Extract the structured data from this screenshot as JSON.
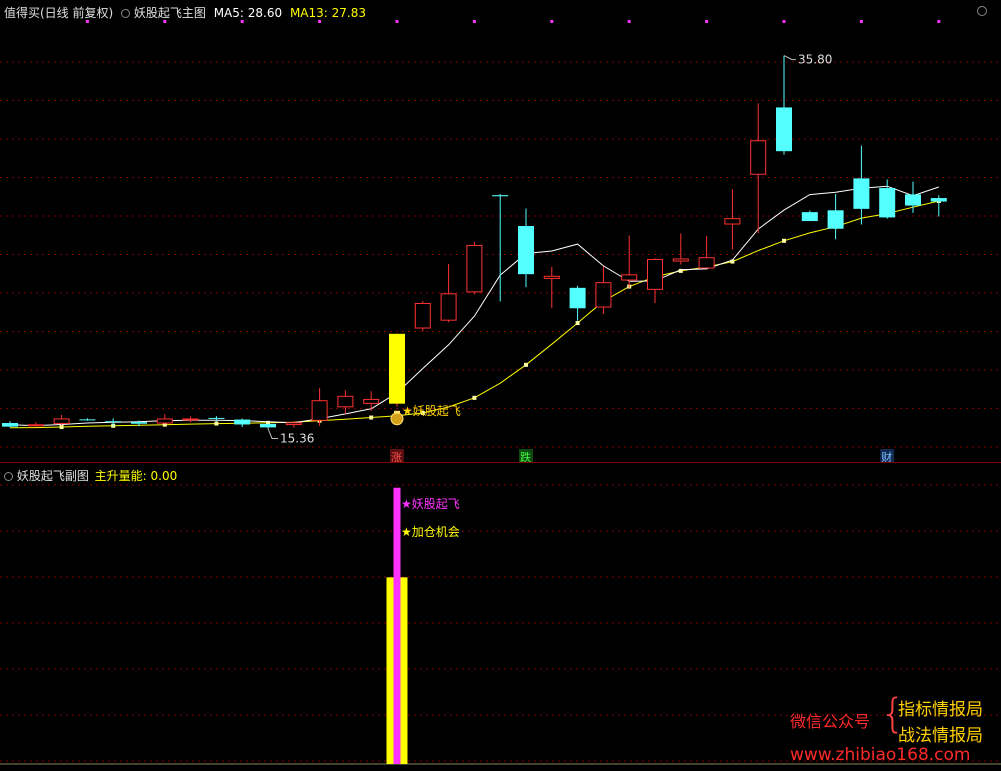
{
  "colors": {
    "up": "#ff3232",
    "down": "#54ffff",
    "ma5": "#ffffff",
    "ma13": "#ffff00",
    "magenta": "#ff32ff",
    "yellow": "#ffff00",
    "grid": "#7f0000",
    "gold": "#ffd000"
  },
  "main_header": {
    "app_name": "值得买(日线 前复权)",
    "indicator": "妖股起飞主图",
    "ma5_label": "MA5: 28.60",
    "ma13_label": "MA13: 27.83"
  },
  "sub_header": {
    "indicator": "妖股起飞副图",
    "series_label": "主升量能: 0.00"
  },
  "chart_data": [
    {
      "type": "candlestick",
      "candles": [
        {
          "o": 15.66,
          "h": 15.76,
          "l": 15.43,
          "c": 15.46
        },
        {
          "o": 15.54,
          "h": 15.7,
          "l": 15.49,
          "c": 15.59
        },
        {
          "o": 15.61,
          "h": 16.11,
          "l": 15.53,
          "c": 15.91
        },
        {
          "o": 15.86,
          "h": 15.92,
          "l": 15.78,
          "c": 15.81
        },
        {
          "o": 15.76,
          "h": 15.92,
          "l": 15.48,
          "c": 15.71
        },
        {
          "o": 15.71,
          "h": 15.8,
          "l": 15.49,
          "c": 15.62
        },
        {
          "o": 15.63,
          "h": 16.14,
          "l": 15.6,
          "c": 15.91
        },
        {
          "o": 15.87,
          "h": 16.03,
          "l": 15.71,
          "c": 15.91
        },
        {
          "o": 15.94,
          "h": 16.04,
          "l": 15.75,
          "c": 15.91
        },
        {
          "o": 15.85,
          "h": 15.91,
          "l": 15.44,
          "c": 15.58
        },
        {
          "o": 15.61,
          "h": 15.61,
          "l": 15.36,
          "c": 15.42
        },
        {
          "o": 15.55,
          "h": 15.76,
          "l": 15.41,
          "c": 15.7
        },
        {
          "o": 15.78,
          "h": 17.57,
          "l": 15.5,
          "c": 16.91
        },
        {
          "o": 16.52,
          "h": 17.45,
          "l": 16.15,
          "c": 17.15
        },
        {
          "o": 16.71,
          "h": 17.4,
          "l": 16.31,
          "c": 16.98
        },
        {
          "o": 16.72,
          "h": 20.55,
          "l": 16.55,
          "c": 20.55
        },
        {
          "o": 20.84,
          "h": 22.34,
          "l": 20.7,
          "c": 22.24
        },
        {
          "o": 21.27,
          "h": 24.38,
          "l": 21.19,
          "c": 22.77
        },
        {
          "o": 22.82,
          "h": 25.59,
          "l": 22.72,
          "c": 25.42
        },
        {
          "o": 28.15,
          "h": 28.21,
          "l": 22.32,
          "c": 28.09
        },
        {
          "o": 26.46,
          "h": 27.41,
          "l": 23.11,
          "c": 23.82
        },
        {
          "o": 23.56,
          "h": 24.22,
          "l": 21.96,
          "c": 23.73
        },
        {
          "o": 23.07,
          "h": 23.18,
          "l": 21.27,
          "c": 21.95
        },
        {
          "o": 21.99,
          "h": 24.25,
          "l": 21.64,
          "c": 23.38
        },
        {
          "o": 23.47,
          "h": 25.94,
          "l": 23.08,
          "c": 23.81
        },
        {
          "o": 22.96,
          "h": 24.7,
          "l": 22.24,
          "c": 24.65
        },
        {
          "o": 24.51,
          "h": 26.05,
          "l": 24.35,
          "c": 24.68
        },
        {
          "o": 24.13,
          "h": 25.91,
          "l": 24.18,
          "c": 24.75
        },
        {
          "o": 26.54,
          "h": 28.48,
          "l": 25.17,
          "c": 26.89
        },
        {
          "o": 29.27,
          "h": 33.18,
          "l": 26.06,
          "c": 31.16
        },
        {
          "o": 32.96,
          "h": 35.8,
          "l": 30.37,
          "c": 30.56
        },
        {
          "o": 27.22,
          "h": 27.31,
          "l": 26.79,
          "c": 26.73
        },
        {
          "o": 27.32,
          "h": 28.21,
          "l": 25.73,
          "c": 26.31
        },
        {
          "o": 29.07,
          "h": 30.86,
          "l": 26.54,
          "c": 27.4
        },
        {
          "o": 28.54,
          "h": 29.01,
          "l": 26.86,
          "c": 26.93
        },
        {
          "o": 28.19,
          "h": 28.89,
          "l": 27.18,
          "c": 27.58
        },
        {
          "o": 27.99,
          "h": 28.14,
          "l": 26.98,
          "c": 27.8
        }
      ],
      "ma5": [
        15.56,
        15.52,
        15.58,
        15.66,
        15.7,
        15.73,
        15.79,
        15.81,
        15.81,
        15.79,
        15.73,
        15.67,
        15.89,
        16.16,
        16.44,
        17.31,
        18.65,
        19.95,
        21.52,
        23.77,
        24.95,
        25.09,
        25.47,
        24.27,
        23.43,
        23.45,
        24.06,
        24.11,
        24.59,
        26.29,
        27.33,
        28.18,
        28.31,
        28.53,
        28.64,
        28.12,
        28.6
      ],
      "ma13": [
        15.4,
        15.41,
        15.44,
        15.48,
        15.51,
        15.54,
        15.57,
        15.6,
        15.63,
        15.65,
        15.67,
        15.7,
        15.79,
        15.87,
        15.96,
        16.06,
        16.21,
        16.54,
        17.04,
        17.84,
        18.85,
        19.98,
        21.14,
        22.34,
        23.14,
        23.68,
        24.0,
        24.21,
        24.51,
        25.11,
        25.65,
        26.08,
        26.42,
        26.89,
        27.14,
        27.49,
        27.83
      ],
      "ma13_marked_indexes": [
        2,
        4,
        6,
        8,
        10,
        12,
        14,
        16,
        18,
        20,
        22,
        24,
        26,
        28,
        30,
        32,
        34,
        36
      ],
      "rocket_index": 15,
      "low_marker": {
        "index": 10,
        "label": "15.36"
      },
      "high_marker": {
        "index": 30,
        "label": "35.80"
      },
      "annotation": {
        "index": 15,
        "text": "★妖股起飞"
      },
      "tags": [
        {
          "index": 15,
          "text": "涨",
          "color": "#ff5050",
          "bg": "#5a1010"
        },
        {
          "index": 20,
          "text": "跌",
          "color": "#40ff40",
          "bg": "#104a10"
        },
        {
          "index": 34,
          "text": "财",
          "color": "#80c0ff",
          "bg": "#102a50"
        }
      ],
      "top_dot_indexes": [
        1,
        2,
        3,
        4,
        5,
        6,
        7,
        8,
        9,
        10,
        11,
        12,
        13,
        14,
        15,
        16,
        17,
        18,
        19,
        20,
        21,
        22,
        23,
        24,
        25,
        26,
        27,
        28,
        29,
        30,
        31,
        32,
        33,
        34,
        35,
        36
      ]
    },
    {
      "type": "bar",
      "indicator": "妖股起飞副图",
      "bars": [
        {
          "index": 15,
          "series": "yellow",
          "value": 100,
          "offset": -1
        },
        {
          "index": 15,
          "series": "magenta",
          "value": 148,
          "offset": 0
        },
        {
          "index": 15,
          "series": "yellow",
          "value": 100,
          "offset": 1
        }
      ],
      "annotations": [
        {
          "index": 15,
          "text": "★妖股起飞",
          "color": "#ff32ff"
        },
        {
          "index": 15,
          "text": "★加仓机会",
          "color": "#ffff00"
        }
      ]
    }
  ],
  "watermark": {
    "wechat": "微信公众号",
    "brace": "{",
    "line1": "指标情报局",
    "line2": "战法情报局",
    "url": "www.zhibiao168.com"
  }
}
